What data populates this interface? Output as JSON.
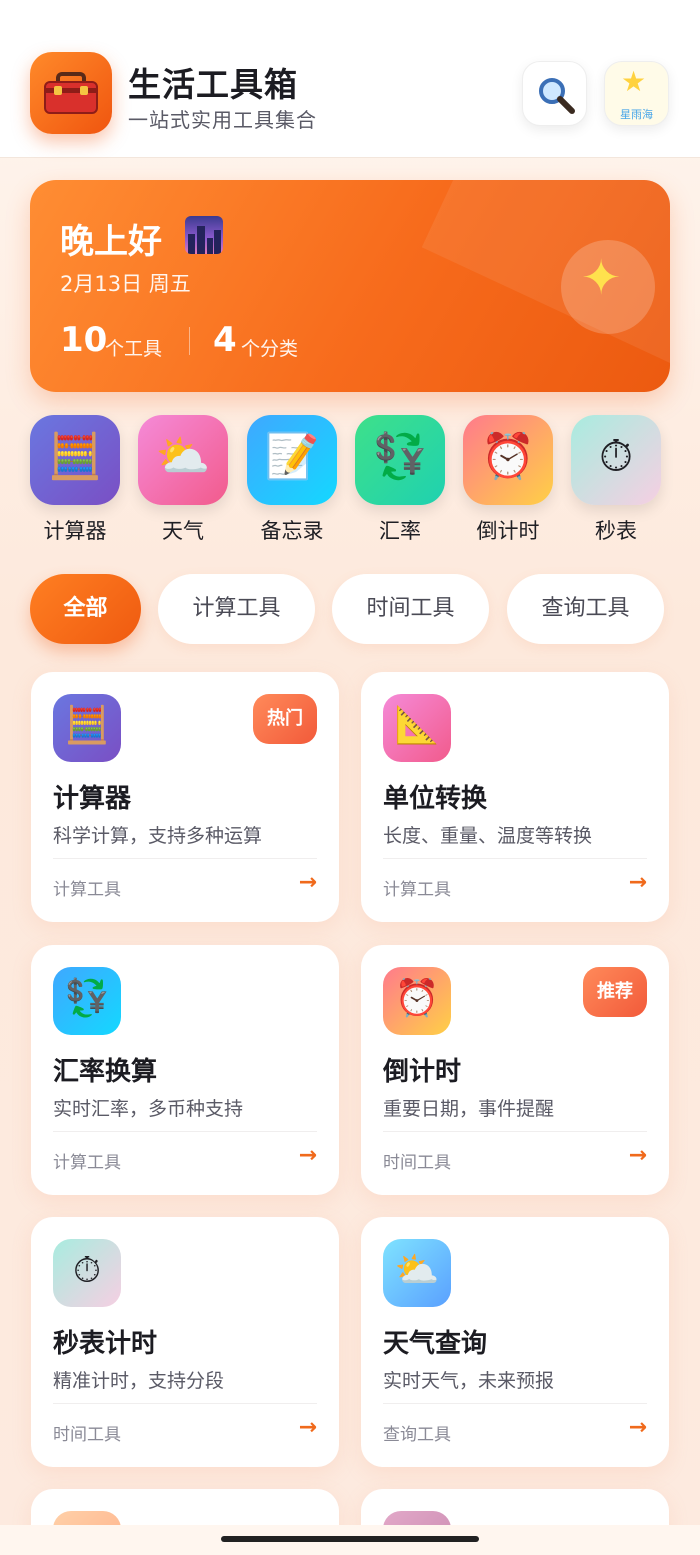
{
  "header": {
    "title": "生活工具箱",
    "subtitle": "一站式实用工具集合",
    "avatar_text": "星雨海"
  },
  "banner": {
    "greeting": "晚上好",
    "date": "2月13日 周五",
    "tool_count": "10",
    "tool_unit": "个工具",
    "category_count": "4",
    "category_unit": "个分类"
  },
  "quick_tools": [
    {
      "label": "计算器",
      "icon": "abacus-icon"
    },
    {
      "label": "天气",
      "icon": "sun-cloud-icon"
    },
    {
      "label": "备忘录",
      "icon": "memo-icon"
    },
    {
      "label": "汇率",
      "icon": "currency-exchange-icon"
    },
    {
      "label": "倒计时",
      "icon": "alarm-clock-icon"
    },
    {
      "label": "秒表",
      "icon": "stopwatch-icon"
    }
  ],
  "tabs": [
    {
      "label": "全部",
      "active": true
    },
    {
      "label": "计算工具",
      "active": false
    },
    {
      "label": "时间工具",
      "active": false
    },
    {
      "label": "查询工具",
      "active": false
    }
  ],
  "cards": [
    {
      "title": "计算器",
      "desc": "科学计算，支持多种运算",
      "category": "计算工具",
      "badge": "热门",
      "icon": "abacus-icon"
    },
    {
      "title": "单位转换",
      "desc": "长度、重量、温度等转换",
      "category": "计算工具",
      "badge": "",
      "icon": "triangle-ruler-icon"
    },
    {
      "title": "汇率换算",
      "desc": "实时汇率，多币种支持",
      "category": "计算工具",
      "badge": "",
      "icon": "currency-exchange-icon"
    },
    {
      "title": "倒计时",
      "desc": "重要日期，事件提醒",
      "category": "时间工具",
      "badge": "推荐",
      "icon": "alarm-clock-icon"
    },
    {
      "title": "秒表计时",
      "desc": "精准计时，支持分段",
      "category": "时间工具",
      "badge": "",
      "icon": "stopwatch-icon"
    },
    {
      "title": "天气查询",
      "desc": "实时天气，未来预报",
      "category": "查询工具",
      "badge": "",
      "icon": "sun-cloud-icon"
    }
  ],
  "arrow_glyph": "→",
  "colors": {
    "accent": "#f06a1c",
    "banner_start": "#ff8d33",
    "banner_end": "#ec5a10"
  }
}
